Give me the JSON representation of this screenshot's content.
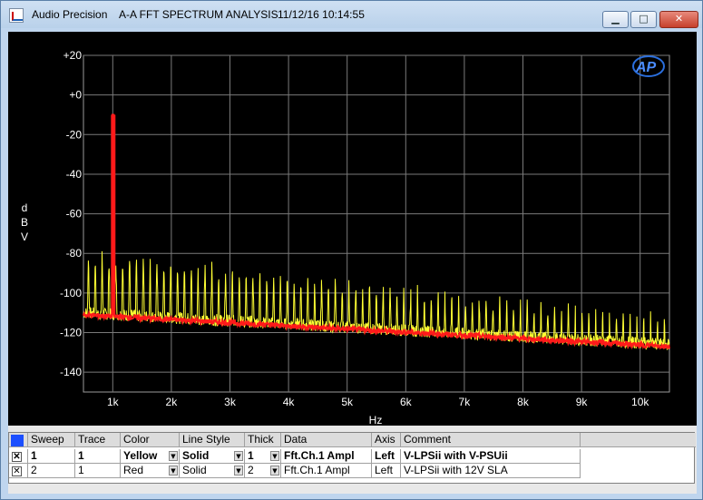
{
  "window": {
    "app_name": "Audio Precision",
    "graph_title": "A-A FFT SPECTRUM ANALYSIS",
    "timestamp": "11/12/16 10:14:55",
    "minimize": "▁",
    "maximize": "□",
    "close": "✕"
  },
  "logo": "AP",
  "colors": {
    "trace1": "#ffff33",
    "trace2": "#ff1a1a",
    "grid": "#7a7a7a",
    "background": "#000000"
  },
  "chart_data": {
    "type": "line",
    "xlabel": "Hz",
    "ylabel": "dBV",
    "ylabel_chars": [
      "d",
      "B",
      "V"
    ],
    "xlim": [
      500,
      10500
    ],
    "ylim": [
      -150,
      20
    ],
    "x_ticks": [
      "1k",
      "2k",
      "3k",
      "4k",
      "5k",
      "6k",
      "7k",
      "8k",
      "9k",
      "10k"
    ],
    "y_ticks": [
      "+20",
      "+0",
      "-20",
      "-40",
      "-60",
      "-80",
      "-100",
      "-120",
      "-140"
    ],
    "series": [
      {
        "name": "V-LPSii with V-PSUii",
        "color": "#ffff33",
        "description": "noise floor with harmonic spurs every ~117 Hz",
        "floor_start": -111,
        "floor_end": -127,
        "spur_spacing_hz": 117,
        "spur_peak_start": -79,
        "spur_peak_end": -112
      },
      {
        "name": "V-LPSii with 12V SLA",
        "color": "#ff1a1a",
        "floor_start": -111,
        "floor_end": -127,
        "peak": {
          "x": 1000,
          "y": -10
        }
      }
    ]
  },
  "legend": {
    "headers": [
      "Sweep",
      "Trace",
      "Color",
      "Line Style",
      "Thick",
      "Data",
      "Axis",
      "Comment"
    ],
    "rows": [
      {
        "checked": "✕",
        "sweep": "1",
        "trace": "1",
        "color": "Yellow",
        "line_style": "Solid",
        "thick": "1",
        "data": "Fft.Ch.1 Ampl",
        "axis": "Left",
        "comment": "V-LPSii with V-PSUii"
      },
      {
        "checked": "✕",
        "sweep": "2",
        "trace": "1",
        "color": "Red",
        "line_style": "Solid",
        "thick": "2",
        "data": "Fft.Ch.1 Ampl",
        "axis": "Left",
        "comment": "V-LPSii with 12V SLA"
      }
    ]
  }
}
